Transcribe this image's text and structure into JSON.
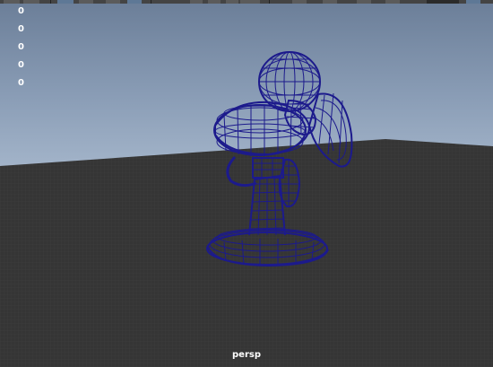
{
  "hud": {
    "values": [
      "0",
      "0",
      "0",
      "0",
      "0"
    ]
  },
  "camera": {
    "name": "persp"
  },
  "scene": {
    "object": "desk-fan",
    "display_mode": "wireframe"
  },
  "colors": {
    "wireframe": "#1c1a8c",
    "ground": "#3c3c3c",
    "grid": "#4b4b4b",
    "sky_top": "#6c7f99",
    "sky_bottom": "#a5b6cb"
  }
}
